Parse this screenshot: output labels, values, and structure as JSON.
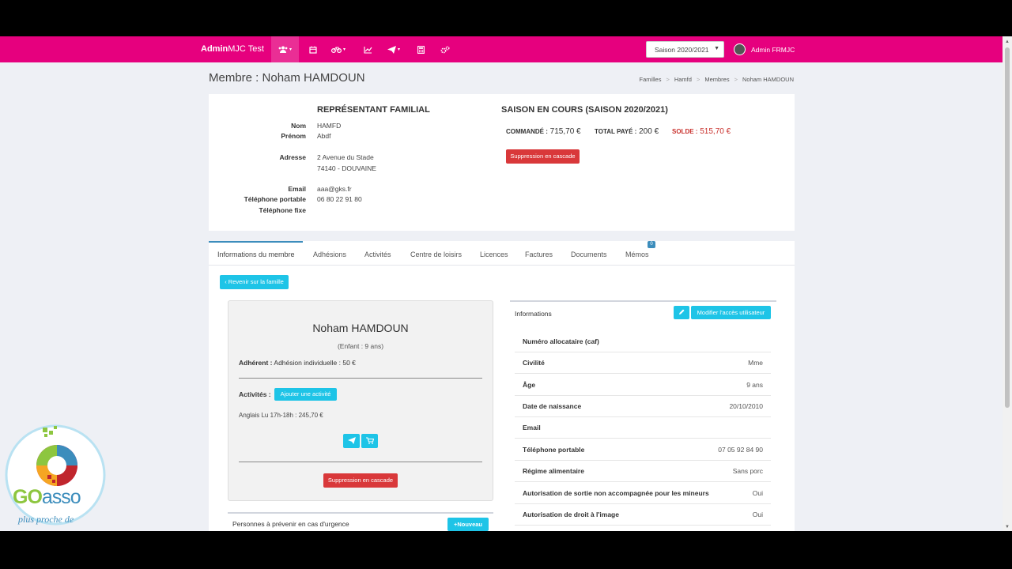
{
  "nav": {
    "brand_bold": "Admin",
    "brand_rest": "MJC Test",
    "season": "Saison 2020/2021",
    "user": "Admin FRMJC"
  },
  "page": {
    "title": "Membre : Noham HAMDOUN",
    "breadcrumb": [
      "Familles",
      "Hamfd",
      "Membres",
      "Noham HAMDOUN"
    ]
  },
  "representant": {
    "title": "REPRÉSENTANT FAMILIAL",
    "nom_label": "Nom",
    "nom": "HAMFD",
    "prenom_label": "Prénom",
    "prenom": "Abdf",
    "adresse_label": "Adresse",
    "adresse1": "2 Avenue du Stade",
    "adresse2": "74140 - DOUVAINE",
    "email_label": "Email",
    "email": "aaa@gks.fr",
    "tel_portable_label": "Téléphone portable",
    "tel_portable": "06 80 22 91 80",
    "tel_fixe_label": "Téléphone fixe"
  },
  "saison": {
    "title": "SAISON EN COURS (SAISON 2020/2021)",
    "commande_label": "COMMANDÉ :",
    "commande": "715,70 €",
    "total_label": "TOTAL PAYÉ :",
    "total": "200 €",
    "solde_label": "SOLDE :",
    "solde": "515,70 €",
    "delete_button": "Suppression en cascade"
  },
  "tabs": [
    "Informations du membre",
    "Adhésions",
    "Activités",
    "Centre de loisirs",
    "Licences",
    "Factures",
    "Documents",
    "Mémos"
  ],
  "memos_badge": "0",
  "back_button": "Revenir sur la famille",
  "member": {
    "name": "Noham HAMDOUN",
    "subtitle": "(Enfant : 9 ans)",
    "adherent_label": "Adhérent :",
    "adherent_value": "Adhésion individuelle : 50 €",
    "activites_label": "Activités :",
    "add_activity_button": "Ajouter une activité",
    "activity": "Anglais Lu 17h-18h : 245,70 €",
    "delete_button": "Suppression en cascade"
  },
  "informations": {
    "title": "Informations",
    "modify_button": "Modifier l'accès utilisateur",
    "rows": [
      {
        "k": "Numéro allocataire (caf)",
        "v": ""
      },
      {
        "k": "Civilité",
        "v": "Mme"
      },
      {
        "k": "Âge",
        "v": "9 ans"
      },
      {
        "k": "Date de naissance",
        "v": "20/10/2010"
      },
      {
        "k": "Email",
        "v": ""
      },
      {
        "k": "Téléphone portable",
        "v": "07 05 92 84 90"
      },
      {
        "k": "Régime alimentaire",
        "v": "Sans porc"
      },
      {
        "k": "Autorisation de sortie non accompagnée pour les mineurs",
        "v": "Oui"
      },
      {
        "k": "Autorisation de droit à l'image",
        "v": "Oui"
      }
    ]
  },
  "urgence": {
    "title": "Personnes à prévenir en cas d'urgence",
    "new_button": "Nouveau"
  },
  "logo": {
    "text_go": "GO",
    "text_asso": "asso",
    "tagline": "plus proche de"
  },
  "colors": {
    "navbar": "#e6007e",
    "cyan": "#1ec4e7",
    "red": "#d9383a",
    "tab_active": "#3c8dbc"
  }
}
